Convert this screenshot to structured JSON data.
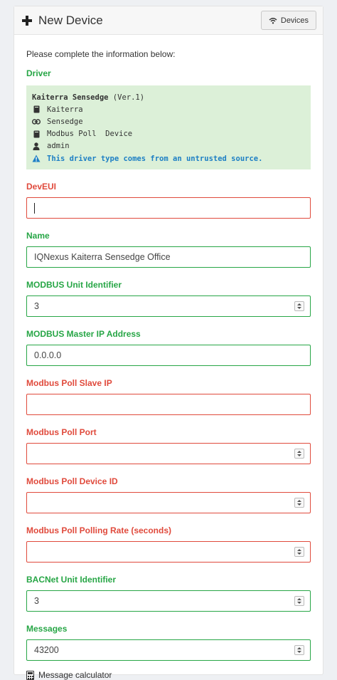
{
  "header": {
    "title": "New Device",
    "devices_button": "Devices",
    "plus_icon": "plus-icon",
    "wifi_icon": "wifi-icon"
  },
  "intro": "Please complete the information below:",
  "driver": {
    "label": "Driver",
    "name": "Kaiterra Sensedge",
    "version": "(Ver.1)",
    "lines": [
      {
        "icon": "book-icon",
        "text": "Kaiterra"
      },
      {
        "icon": "link-icon",
        "text": "Sensedge"
      },
      {
        "icon": "book-icon",
        "text": "Modbus Poll  Device"
      },
      {
        "icon": "user-icon",
        "text": "admin"
      }
    ],
    "warning": "This driver type comes from an untrusted source."
  },
  "fields": {
    "deveui": {
      "label": "DevEUI",
      "value": ""
    },
    "name": {
      "label": "Name",
      "value": "IQNexus Kaiterra Sensedge Office"
    },
    "modbus_unit": {
      "label": "MODBUS Unit Identifier",
      "value": "3"
    },
    "modbus_master_ip": {
      "label": "MODBUS Master IP Address",
      "value": "0.0.0.0"
    },
    "poll_slave_ip": {
      "label": "Modbus Poll Slave IP",
      "value": ""
    },
    "poll_port": {
      "label": "Modbus Poll Port",
      "value": ""
    },
    "poll_device_id": {
      "label": "Modbus Poll Device ID",
      "value": ""
    },
    "poll_rate": {
      "label": "Modbus Poll Polling Rate (seconds)",
      "value": ""
    },
    "bacnet_unit": {
      "label": "BACNet Unit Identifier",
      "value": "3"
    },
    "messages": {
      "label": "Messages",
      "value": "43200"
    }
  },
  "calculator_link": "Message calculator",
  "colors": {
    "valid": "#27a646",
    "invalid": "#e04a3c",
    "driver_bg": "#dcf0d8",
    "warning": "#1d7fc4"
  }
}
